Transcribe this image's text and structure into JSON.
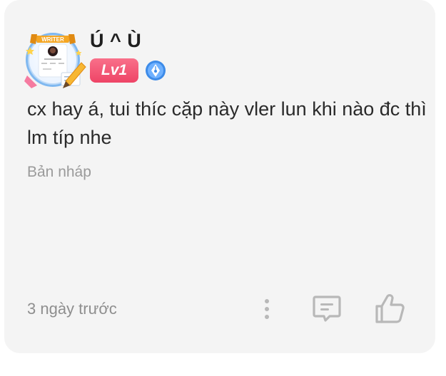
{
  "comment": {
    "avatar": {
      "frame_label": "WRITER",
      "icon": "avatar-writer-frame"
    },
    "username": "Ú ^ Ù",
    "level": "Lv1",
    "level_color": "#ee4466",
    "badge_icon": "pen-nib-badge-icon",
    "badge_color": "#3d8be8",
    "text": "cx hay á, tui thíc cặp này vler lun khi nào đc thì lm típ nhe",
    "status": "Bản nháp",
    "time": "3 ngày trước",
    "actions": {
      "more_icon": "more-vertical-icon",
      "reply_icon": "comment-icon",
      "like_icon": "thumbs-up-icon"
    }
  }
}
